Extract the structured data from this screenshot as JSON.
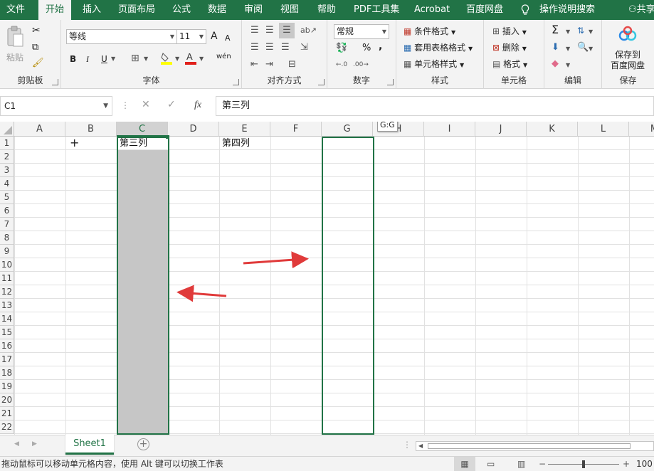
{
  "ribbon_tabs": [
    {
      "label": "文件"
    },
    {
      "label": "开始"
    },
    {
      "label": "插入"
    },
    {
      "label": "页面布局"
    },
    {
      "label": "公式"
    },
    {
      "label": "数据"
    },
    {
      "label": "审阅"
    },
    {
      "label": "视图"
    },
    {
      "label": "帮助"
    },
    {
      "label": "PDF工具集"
    },
    {
      "label": "Acrobat"
    },
    {
      "label": "百度网盘"
    }
  ],
  "tell_me": "操作说明搜索",
  "share": "共享",
  "clipboard": {
    "paste": "粘贴",
    "group": "剪贴板"
  },
  "font": {
    "name": "等线",
    "size": "11",
    "grow": "A",
    "shrink": "A",
    "bold": "B",
    "italic": "I",
    "underline": "U",
    "phonetic": "wén",
    "group": "字体"
  },
  "alignment": {
    "group": "对齐方式"
  },
  "number": {
    "format": "常规",
    "percent": "%",
    "comma": ",",
    "group": "数字"
  },
  "styles": {
    "conditional": "条件格式",
    "table": "套用表格格式",
    "cell": "单元格样式",
    "group": "样式"
  },
  "cells": {
    "insert": "插入",
    "delete": "删除",
    "format": "格式",
    "group": "单元格"
  },
  "editing": {
    "group": "编辑"
  },
  "save_to": {
    "line1": "保存到",
    "line2": "百度网盘",
    "group": "保存"
  },
  "formula_bar": {
    "name_box": "C1",
    "fx": "fx",
    "content": "第三列"
  },
  "columns": [
    "A",
    "B",
    "C",
    "D",
    "E",
    "F",
    "G",
    "H",
    "I",
    "J",
    "K",
    "L",
    "M"
  ],
  "rows": [
    "1",
    "2",
    "3",
    "4",
    "5",
    "6",
    "7",
    "8",
    "9",
    "10",
    "11",
    "12",
    "13",
    "14",
    "15",
    "16",
    "17",
    "18",
    "19",
    "20",
    "21",
    "22"
  ],
  "cells_data": {
    "C1": "第三列",
    "E1": "第四列"
  },
  "drag_tooltip": "G:G",
  "sheet_tab": "Sheet1",
  "status_text": "拖动鼠标可以移动单元格内容，使用 Alt 键可以切换工作表",
  "zoom": "100",
  "colors": {
    "accent": "#217346",
    "arrow": "#e03a3a",
    "selection_fill": "#c6c6c6"
  }
}
